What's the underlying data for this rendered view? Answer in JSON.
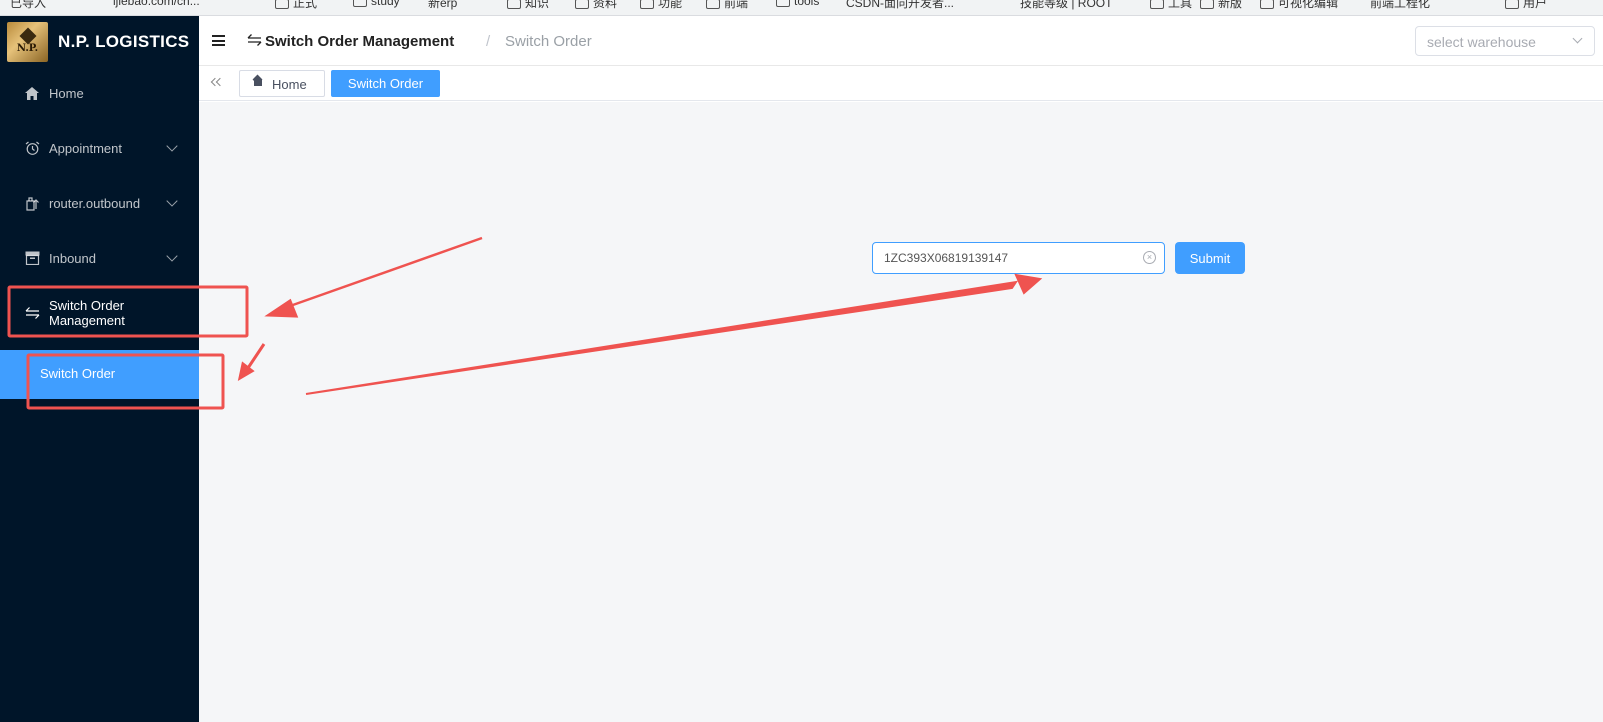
{
  "bookmarks": [
    {
      "label": "已导入",
      "folder": false
    },
    {
      "label": "ijiebao.com/ch...",
      "folder": false
    },
    {
      "label": "正式",
      "folder": true
    },
    {
      "label": "study",
      "folder": true
    },
    {
      "label": "新erp",
      "folder": false
    },
    {
      "label": "知识",
      "folder": true
    },
    {
      "label": "资料",
      "folder": true
    },
    {
      "label": "功能",
      "folder": true
    },
    {
      "label": "前端",
      "folder": true
    },
    {
      "label": "tools",
      "folder": true
    },
    {
      "label": "CSDN-面向开发者...",
      "folder": false
    },
    {
      "label": "技能等级 | ROOT",
      "folder": false
    },
    {
      "label": "工具",
      "folder": true
    },
    {
      "label": "新版",
      "folder": true
    },
    {
      "label": "可视化编辑",
      "folder": true
    },
    {
      "label": "前端工程化",
      "folder": false
    },
    {
      "label": "用户",
      "folder": true
    }
  ],
  "sidebar": {
    "brand": "N.P. LOGISTICS",
    "logo_text": "N.P.",
    "items": [
      {
        "label": "Home",
        "icon": "home-icon",
        "has_arrow": false
      },
      {
        "label": "Appointment",
        "icon": "alarm-clock-icon",
        "has_arrow": true
      },
      {
        "label": "router.outbound",
        "icon": "outbound-box-icon",
        "has_arrow": true
      },
      {
        "label": "Inbound",
        "icon": "archive-box-icon",
        "has_arrow": true
      },
      {
        "label": "Switch Order Management",
        "icon": "switch-arrows-icon",
        "has_arrow": false
      }
    ],
    "submenu": {
      "label": "Switch Order"
    }
  },
  "header": {
    "breadcrumb_title": "Switch Order Management",
    "breadcrumb_separator": "/",
    "breadcrumb_current": "Switch Order",
    "warehouse_placeholder": "select warehouse"
  },
  "tabs": {
    "home": "Home",
    "active": "Switch Order"
  },
  "form": {
    "order_value": "1ZC393X06819139147",
    "submit_label": "Submit"
  },
  "annotation_color": "#ef5350",
  "accent_color": "#409eff",
  "sidebar_color": "#001529"
}
